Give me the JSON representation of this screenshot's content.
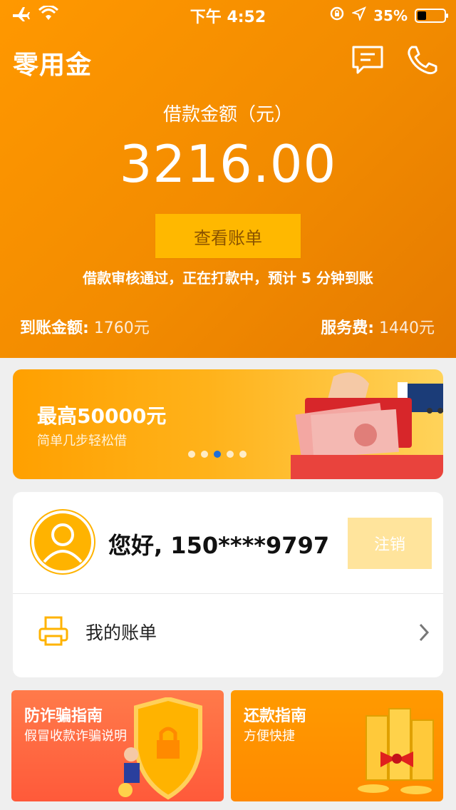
{
  "status_bar": {
    "time": "下午 4:52",
    "battery_text": "35%",
    "battery_level": 0.35
  },
  "header": {
    "app_title": "零用金",
    "loan_label": "借款金额（元）",
    "loan_amount": "3216.00",
    "view_bill_label": "查看账单",
    "status_text": "借款审核通过，正在打款中，预计 5 分钟到账",
    "received_label": "到账金额:",
    "received_value": "1760元",
    "fee_label": "服务费:",
    "fee_value": "1440元"
  },
  "banner": {
    "title": "最高50000元",
    "subtitle": "简单几步轻松借",
    "slides_total": 5,
    "active_slide_index": 2
  },
  "account": {
    "greeting": "您好, 150****9797",
    "logout_label": "注销",
    "my_bill_label": "我的账单"
  },
  "tiles": {
    "anti_fraud": {
      "title": "防诈骗指南",
      "subtitle": "假冒收款诈骗说明"
    },
    "repay": {
      "title": "还款指南",
      "subtitle": "方便快捷"
    }
  },
  "colors": {
    "header_orange": "#f28b00",
    "button_yellow": "#ffb800",
    "banner_dot_active": "#1f6fd8",
    "logout_bg": "#ffe49c"
  },
  "icons": [
    "airplane-icon",
    "wifi-icon",
    "orientation-lock-icon",
    "location-arrow-icon",
    "battery-icon",
    "message-icon",
    "phone-icon",
    "user-avatar-icon",
    "printer-icon",
    "chevron-right-icon",
    "shield-lock-icon",
    "gold-coins-icon",
    "red-envelope-icon"
  ]
}
